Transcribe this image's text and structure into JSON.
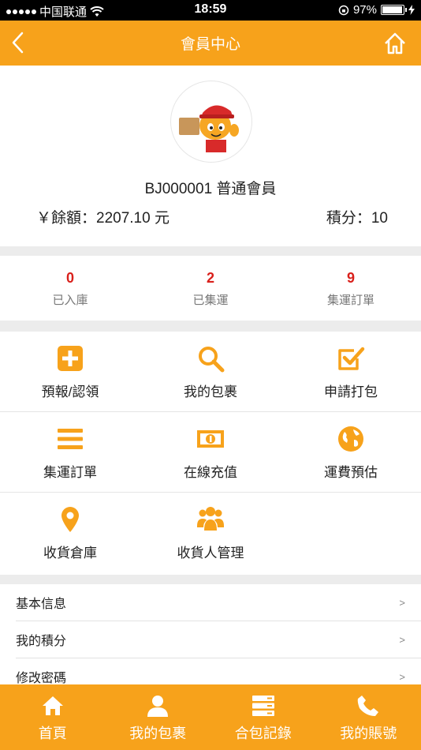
{
  "status_bar": {
    "carrier": "中国联通",
    "time": "18:59",
    "battery": "97%"
  },
  "nav": {
    "title": "會員中心",
    "back_icon": "chevron-left-icon",
    "home_icon": "home-icon"
  },
  "profile": {
    "member_line": "BJ000001 普通會員",
    "balance_label": "￥餘額：2207.10 元",
    "points_label": "積分：10"
  },
  "stats": [
    {
      "value": "0",
      "label": "已入庫"
    },
    {
      "value": "2",
      "label": "已集運"
    },
    {
      "value": "9",
      "label": "集運訂單"
    }
  ],
  "grid": [
    {
      "label": "預報/認領",
      "icon": "plus-square-icon"
    },
    {
      "label": "我的包裹",
      "icon": "search-icon"
    },
    {
      "label": "申請打包",
      "icon": "checkbox-icon"
    },
    {
      "label": "集運訂單",
      "icon": "list-icon"
    },
    {
      "label": "在線充值",
      "icon": "money-icon"
    },
    {
      "label": "運費預估",
      "icon": "globe-icon"
    },
    {
      "label": "收貨倉庫",
      "icon": "location-pin-icon"
    },
    {
      "label": "收貨人管理",
      "icon": "users-icon"
    }
  ],
  "menu": [
    {
      "label": "基本信息",
      "arrow": ">"
    },
    {
      "label": "我的積分",
      "arrow": ">"
    },
    {
      "label": "修改密碼",
      "arrow": ">"
    }
  ],
  "tabs": [
    {
      "label": "首頁",
      "icon": "home-icon"
    },
    {
      "label": "我的包裹",
      "icon": "user-icon"
    },
    {
      "label": "合包記錄",
      "icon": "server-icon"
    },
    {
      "label": "我的賬號",
      "icon": "phone-icon"
    }
  ],
  "colors": {
    "accent": "#f7a21b",
    "stat_number": "#d9201b"
  }
}
